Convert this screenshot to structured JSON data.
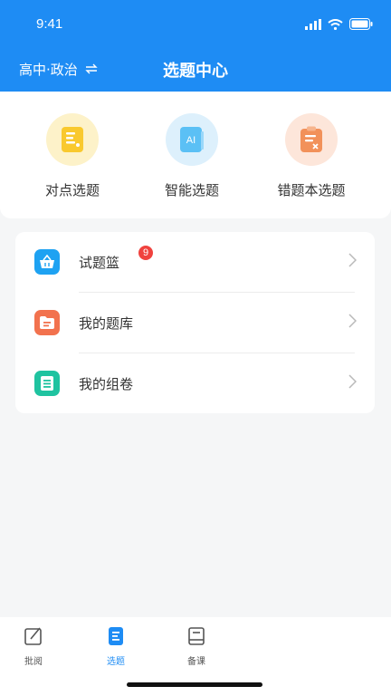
{
  "status": {
    "time": "9:41"
  },
  "header": {
    "subject": "高中·政治",
    "title": "选题中心"
  },
  "features": [
    {
      "label": "对点选题",
      "icon": "document-yellow-icon"
    },
    {
      "label": "智能选题",
      "icon": "ai-document-icon"
    },
    {
      "label": "错题本选题",
      "icon": "clipboard-wrong-icon"
    }
  ],
  "list": [
    {
      "label": "试题篮",
      "icon": "basket-icon",
      "badge": "9"
    },
    {
      "label": "我的题库",
      "icon": "folder-icon"
    },
    {
      "label": "我的组卷",
      "icon": "list-document-icon"
    }
  ],
  "tabs": [
    {
      "label": "批阅",
      "active": false
    },
    {
      "label": "选题",
      "active": true
    },
    {
      "label": "备课",
      "active": false
    }
  ],
  "colors": {
    "primary": "#1e8cf4",
    "badge": "#f0423e"
  }
}
